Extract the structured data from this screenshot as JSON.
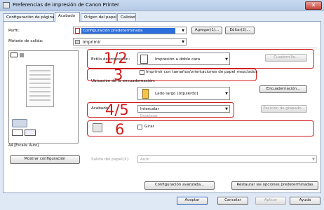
{
  "window": {
    "title": "Preferencias de impresión de Canon Printer",
    "close": "✕"
  },
  "tabs": [
    "Configuración de página",
    "Acabado",
    "Origen del papel",
    "Calidad"
  ],
  "perfil": {
    "label": "Perfil:",
    "value": "Configuración predeterminada",
    "add": "Agregar(1)...",
    "edit": "Editar(2)..."
  },
  "metodo": {
    "label": "Método de salida:",
    "value": "Imprimir"
  },
  "estilo": {
    "label": "Estilo de impresión:",
    "value": "Impresión a doble cara",
    "btn": "Cuadernillo..."
  },
  "mezclados": {
    "label": "Imprimir con tamaños/orientaciones de papel mezclados"
  },
  "ubicacion": {
    "label": "Ubicación de la encuadernación:",
    "value": "Lado largo [Izquierdo]",
    "btn": "Encuadernación..."
  },
  "acabado": {
    "label": "Acabado:",
    "value": "Intercalar",
    "btn": "Posición de grapado...",
    "sub": "Desplazar"
  },
  "girar": {
    "label": "Girar"
  },
  "preview": {
    "caption": "A4 [Escala: Auto]"
  },
  "bottom": {
    "mostrar": "Mostrar configuración",
    "salida_label": "Salida del papel(X):",
    "salida_value": "Auto",
    "avanzada": "Configuración avanzada...",
    "restaurar": "Restaurar las opciones predeterminadas"
  },
  "dialog": {
    "ok": "Aceptar",
    "cancel": "Cancelar",
    "apply": "Aplicar",
    "help": "Ayuda"
  },
  "annotations": [
    "1/2",
    "3",
    "4/5",
    "6"
  ],
  "colors": {
    "annotation": "#d01c1c",
    "accent": "#1e5fd0"
  }
}
